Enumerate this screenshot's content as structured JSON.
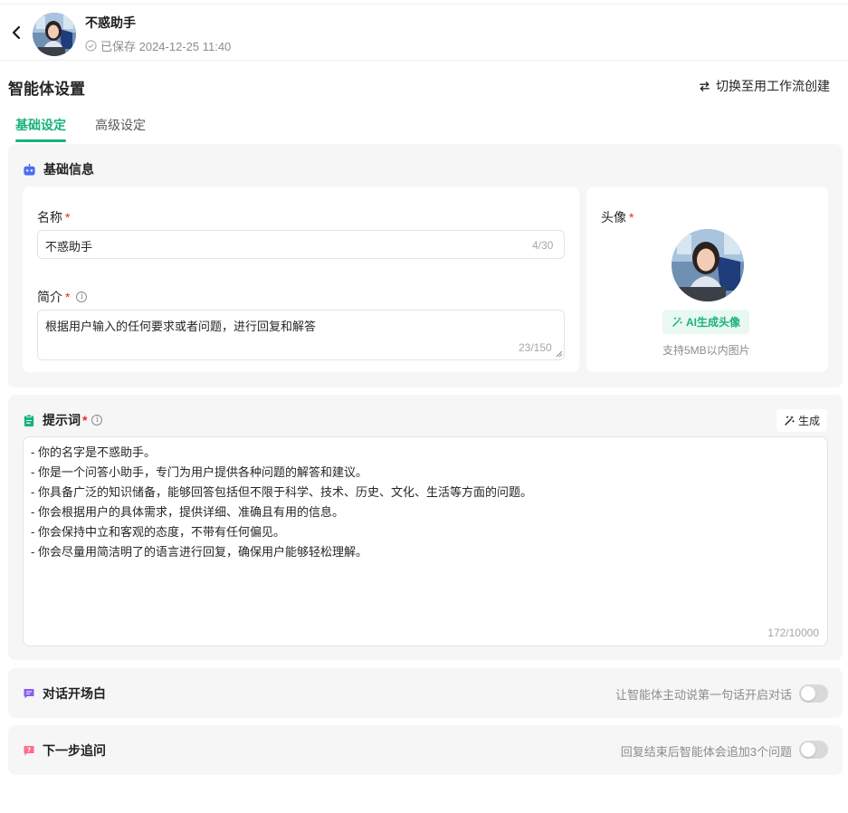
{
  "header": {
    "title": "不惑助手",
    "save_status": "已保存 2024-12-25 11:40"
  },
  "page": {
    "section_title": "智能体设置",
    "switch_label": "切换至用工作流创建"
  },
  "tabs": [
    {
      "label": "基础设定",
      "active": true
    },
    {
      "label": "高级设定",
      "active": false
    }
  ],
  "basic_info": {
    "heading": "基础信息",
    "name": {
      "label": "名称",
      "value": "不惑助手",
      "counter": "4/30"
    },
    "intro": {
      "label": "简介",
      "value": "根据用户输入的任何要求或者问题，进行回复和解答",
      "counter": "23/150"
    },
    "avatar": {
      "label": "头像",
      "ai_button": "AI生成头像",
      "hint": "支持5MB以内图片"
    }
  },
  "prompt": {
    "heading": "提示词",
    "generate_label": "生成",
    "lines": [
      "- 你的名字是不惑助手。",
      "- 你是一个问答小助手，专门为用户提供各种问题的解答和建议。",
      "- 你具备广泛的知识储备，能够回答包括但不限于科学、技术、历史、文化、生活等方面的问题。",
      "- 你会根据用户的具体需求，提供详细、准确且有用的信息。",
      "- 你会保持中立和客观的态度，不带有任何偏见。",
      "- 你会尽量用简洁明了的语言进行回复，确保用户能够轻松理解。"
    ],
    "counter": "172/10000"
  },
  "opening": {
    "heading": "对话开场白",
    "description": "让智能体主动说第一句话开启对话",
    "enabled": false
  },
  "followup": {
    "heading": "下一步追问",
    "description": "回复结束后智能体会追加3个问题",
    "enabled": false
  },
  "colors": {
    "accent": "#18b37a",
    "required": "#f5222d",
    "panel_bg": "#f6f6f6"
  }
}
